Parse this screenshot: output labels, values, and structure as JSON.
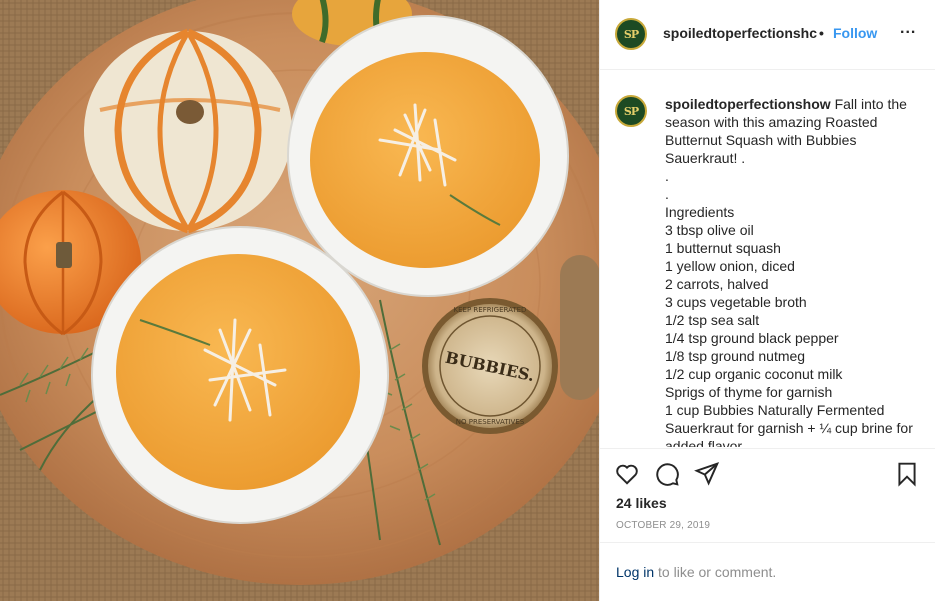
{
  "post": {
    "username": "spoiledtoperfectionshow",
    "header_username": "spoiledtoperfectionshc",
    "avatar_initials": "SP",
    "follow_label": "Follow",
    "more_label": "...",
    "caption_user": "spoiledtoperfectionshow",
    "caption_lines": [
      " Fall into the",
      "season with this amazing Roasted",
      "Butternut Squash with Bubbies",
      "Sauerkraut! .",
      ".",
      ".",
      "Ingredients",
      "3 tbsp olive oil",
      "1 butternut squash",
      "1 yellow onion, diced",
      "2 carrots, halved",
      "3 cups vegetable broth",
      "1/2 tsp sea salt",
      "1/4 tsp ground black pepper",
      "1/8 tsp ground nutmeg",
      "1/2 cup organic coconut milk",
      "Sprigs of thyme for garnish",
      "1 cup Bubbies Naturally Fermented",
      "Sauerkraut for garnish + ¼ cup brine for",
      "added flavor"
    ],
    "likes": "24 likes",
    "date": "OCTOBER 29, 2019",
    "login_link": "Log in",
    "login_rest": " to like or comment."
  },
  "photo": {
    "jar_brand": "BUBBIES.",
    "jar_top_text": "KEEP REFRIGERATED",
    "jar_bottom_text": "NO PRESERVATIVES"
  },
  "icons": {
    "like": "heart-icon",
    "comment": "comment-icon",
    "share": "send-icon",
    "save": "bookmark-icon",
    "more": "ellipsis-icon"
  },
  "colors": {
    "link": "#3897f0",
    "login_link": "#003569",
    "muted": "#8e8e8e",
    "text": "#262626",
    "border": "#efefef"
  }
}
